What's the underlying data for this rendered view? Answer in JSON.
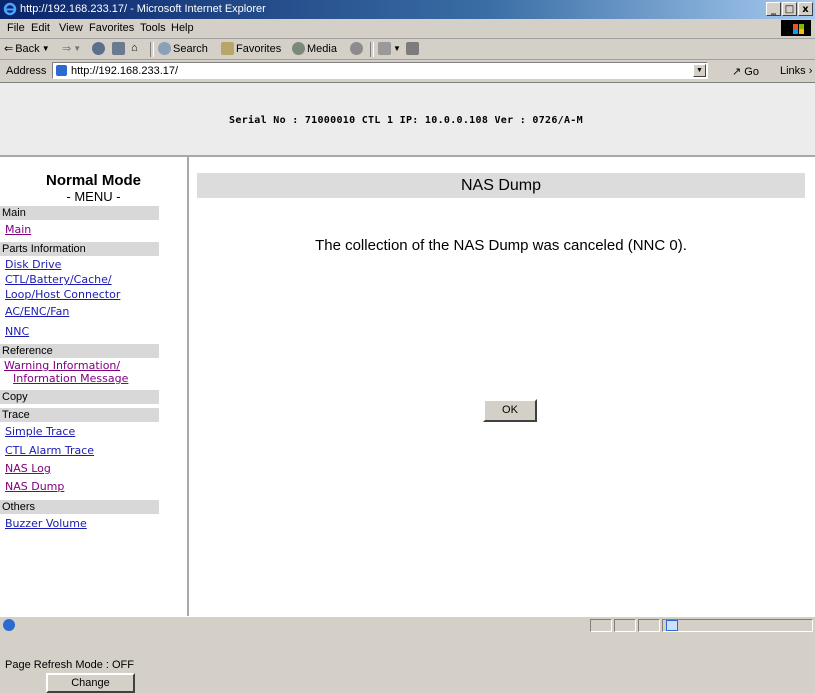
{
  "window": {
    "title": "http://192.168.233.17/ - Microsoft Internet Explorer",
    "min": "_",
    "max": "□",
    "close": "x"
  },
  "menubar": {
    "file": "File",
    "edit": "Edit",
    "view": "View",
    "favorites": "Favorites",
    "tools": "Tools",
    "help": "Help"
  },
  "toolbar": {
    "back": "Back",
    "search": "Search",
    "favorites": "Favorites",
    "media": "Media"
  },
  "address": {
    "label": "Address",
    "url": "http://192.168.233.17/",
    "go": "Go",
    "links": "Links"
  },
  "header": {
    "serial": "Serial No : 71000010  CTL 1  IP: 10.0.0.108  Ver : 0726/A-M"
  },
  "sidebar": {
    "mode": "Normal Mode",
    "menu": "- MENU -",
    "cat_main": "Main",
    "link_main": "Main",
    "cat_parts": "Parts Information",
    "link_disk": "Disk Drive",
    "link_ctl1": "CTL/Battery/Cache/",
    "link_ctl2": "Loop/Host Connector",
    "link_ac": "AC/ENC/Fan",
    "link_nnc": "NNC",
    "cat_reference": "Reference",
    "link_warn1": "Warning Information/",
    "link_warn2": "Information Message",
    "cat_copy": "Copy",
    "cat_trace": "Trace",
    "link_simple": "Simple Trace",
    "link_ctlalarm": "CTL Alarm Trace",
    "link_naslog": "NAS Log",
    "link_nasdump": "NAS Dump",
    "cat_others": "Others",
    "link_buzzer": "Buzzer Volume",
    "refresh": "Page Refresh Mode : OFF",
    "change": "Change"
  },
  "main": {
    "title": "NAS Dump",
    "message": "The collection of the NAS Dump was canceled (NNC 0).",
    "ok": "OK"
  }
}
